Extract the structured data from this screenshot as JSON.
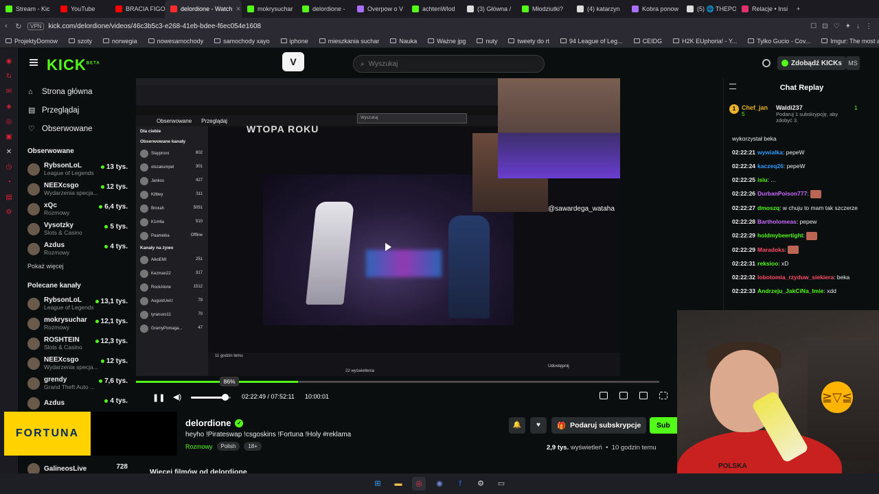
{
  "browser": {
    "tabs": [
      {
        "label": "Stream - Kic",
        "color": "#53fc18"
      },
      {
        "label": "YouTube",
        "color": "#ff0000"
      },
      {
        "label": "BRACIA FIGO",
        "color": "#ff0000"
      },
      {
        "label": "delordione - Watch",
        "color": "#ff2a2a",
        "active": true
      },
      {
        "label": "mokrysuchar",
        "color": "#53fc18"
      },
      {
        "label": "delordione -",
        "color": "#53fc18"
      },
      {
        "label": "Overpow o V",
        "color": "#a970ff"
      },
      {
        "label": "achtenWlod",
        "color": "#53fc18"
      },
      {
        "label": "(3) Główna /",
        "color": "#dddddd"
      },
      {
        "label": "Młodziutki?",
        "color": "#53fc18"
      },
      {
        "label": "(4) katarzyn",
        "color": "#dddddd"
      },
      {
        "label": "Kobra ponow",
        "color": "#a970ff"
      },
      {
        "label": "(5) 🌐 THEPO",
        "color": "#dddddd"
      },
      {
        "label": "Relacje • Insi",
        "color": "#e1306c"
      }
    ],
    "vpn_label": "VPN",
    "url": "kick.com/delordione/videos/46c3b5c3-e268-41eb-bdee-f6ec054e1608",
    "bookmarks": [
      "ProjektyDomow",
      "szoty",
      "norwegia",
      "nowesamochody",
      "samochody xayo",
      "iphone",
      "mieszkania suchar",
      "Nauka",
      "Ważne jpg",
      "nuty",
      "tweety do rt",
      "94 League of Leg...",
      "CEIDG",
      "H2K EUphoria! - Y...",
      "Tylko Gucio - Cov...",
      "Imgur: The most a..."
    ]
  },
  "kick": {
    "logo": "KICK",
    "logo_sup": "BETA",
    "search_placeholder": "Wyszukaj",
    "get_kicks": "Zdobądź KICKs",
    "user_initials": "MS",
    "nav": [
      {
        "label": "Strona główna",
        "icon": "home-icon"
      },
      {
        "label": "Przeglądaj",
        "icon": "browse-icon"
      },
      {
        "label": "Obserwowane",
        "icon": "heart-icon"
      }
    ],
    "followed_title": "Obserwowane",
    "followed": [
      {
        "name": "RybsonLoL",
        "category": "League of Legends",
        "viewers": "13 tys."
      },
      {
        "name": "NEEXcsgo",
        "category": "Wydarzenia specja...",
        "viewers": "12 tys."
      },
      {
        "name": "xQc",
        "category": "Rozmowy",
        "viewers": "6,4 tys."
      },
      {
        "name": "Vysotzky",
        "category": "Slots & Casino",
        "viewers": "5 tys."
      },
      {
        "name": "Azdus",
        "category": "Rozmowy",
        "viewers": "4 tys."
      }
    ],
    "show_more": "Pokaż więcej",
    "recommended_title": "Polecane kanały",
    "recommended": [
      {
        "name": "RybsonLoL",
        "category": "League of Legends",
        "viewers": "13,1 tys."
      },
      {
        "name": "mokrysuchar",
        "category": "Rozmowy",
        "viewers": "12,1 tys."
      },
      {
        "name": "ROSHTEIN",
        "category": "Slots & Casino",
        "viewers": "12,3 tys."
      },
      {
        "name": "NEEXcsgo",
        "category": "Wydarzenia specja...",
        "viewers": "12 tys."
      },
      {
        "name": "grendy",
        "category": "Grand Theft Auto ...",
        "viewers": "7,6 tys."
      },
      {
        "name": "Azdus",
        "category": "",
        "viewers": "4 tys."
      }
    ],
    "last_sidebar": {
      "name": "GalineosLive",
      "viewers": "728"
    }
  },
  "player": {
    "inner_title": "WTOPA ROKU",
    "inner_nav": [
      "Obserwowane",
      "Przeglądaj"
    ],
    "inner_search": "Wyszukaj",
    "inner_for_you": "Dla ciebie",
    "inner_followed_header": "Obserwowane kanały",
    "inner_channels": [
      {
        "name": "Slayproxx",
        "viewers": "802"
      },
      {
        "name": "olszakumpel",
        "viewers": "301"
      },
      {
        "name": "Jankos",
        "viewers": "427"
      },
      {
        "name": "Kilttwy",
        "viewers": "311"
      },
      {
        "name": "Broxah",
        "viewers": "5051"
      },
      {
        "name": "K1m6a",
        "viewers": "510"
      },
      {
        "name": "Paameika",
        "viewers": "Offline"
      }
    ],
    "inner_live_header": "Kanały na żywo",
    "inner_live": [
      {
        "name": "AikoEMI",
        "viewers": "251"
      },
      {
        "name": "Kezman22",
        "viewers": "317"
      },
      {
        "name": "RockAlone",
        "viewers": "1512"
      },
      {
        "name": "AugustUwU",
        "viewers": "79"
      },
      {
        "name": "tyranuxs11",
        "viewers": "70"
      },
      {
        "name": "GramyPomaga...",
        "viewers": "47"
      }
    ],
    "tag_name": "@sawardega_wataha",
    "inner_time": "11 godzin temu",
    "inner_views": "22 wyświetlenia",
    "inner_share": "Udostępnij",
    "volume_percent": "86%",
    "volume_level": 0.86,
    "progress": 0.31,
    "timecode": "02:22:49 / 07:52:11",
    "clock": "10:00:01"
  },
  "video": {
    "channel": "delordione",
    "title": "heyho !Pirateswap !csgoskins !Fortuna !Holy #reklama",
    "category": "Rozmowy",
    "language": "Polish",
    "age": "18+",
    "views": "2,9 tys.",
    "views_label": "wyświetleń",
    "time_ago": "10 godzin temu",
    "subscribe_gift": "Podaruj subskrypcje",
    "follow": "Sub",
    "more_videos": "Więcej filmów od delordione"
  },
  "chat": {
    "title": "Chat Replay",
    "pinned": {
      "gifter": "Chef_jan",
      "gifter_count": "5",
      "user": "Waldi237",
      "count": "1",
      "note": "Podaruj 1 subskrypcję, aby zdobyć 3."
    },
    "first_line": "wykorzystał beka",
    "messages": [
      {
        "time": "02:22:21",
        "user": "wywialka",
        "color": "#2f9bff",
        "text": "pepeW"
      },
      {
        "time": "02:22:24",
        "user": "kaczeq26",
        "color": "#2f9bff",
        "text": "pepeW"
      },
      {
        "time": "02:22:25",
        "user": "isiu",
        "color": "#53fc18",
        "text": "..."
      },
      {
        "time": "02:22:26",
        "user": "DurbanPoison777",
        "color": "#c96bff",
        "text": ""
      },
      {
        "time": "02:22:27",
        "user": "dmoszq",
        "color": "#53fc18",
        "text": "w chuju to mam tak szczerze"
      },
      {
        "time": "02:22:28",
        "user": "Bartholomeas",
        "color": "#c96bff",
        "text": "pepew"
      },
      {
        "time": "02:22:29",
        "user": "holdmybeertight",
        "color": "#53fc18",
        "text": ""
      },
      {
        "time": "02:22:29",
        "user": "Maradoks",
        "color": "#ff4d6a",
        "text": ""
      },
      {
        "time": "02:22:31",
        "user": "reksioo",
        "color": "#53fc18",
        "text": "xD"
      },
      {
        "time": "02:22:32",
        "user": "lobotomia_rzyduw_siekiera",
        "color": "#ff4d6a",
        "text": "beka"
      },
      {
        "time": "02:22:33",
        "user": "Andrzeju_JakCiNa_Imie",
        "color": "#53fc18",
        "text": "xdd"
      }
    ]
  },
  "ad": {
    "brand": "FORTUNA"
  },
  "webcam": {
    "shirt_text": "POLSKA"
  },
  "colors": {
    "kick_green": "#53fc18",
    "bg": "#0b0e0f"
  }
}
